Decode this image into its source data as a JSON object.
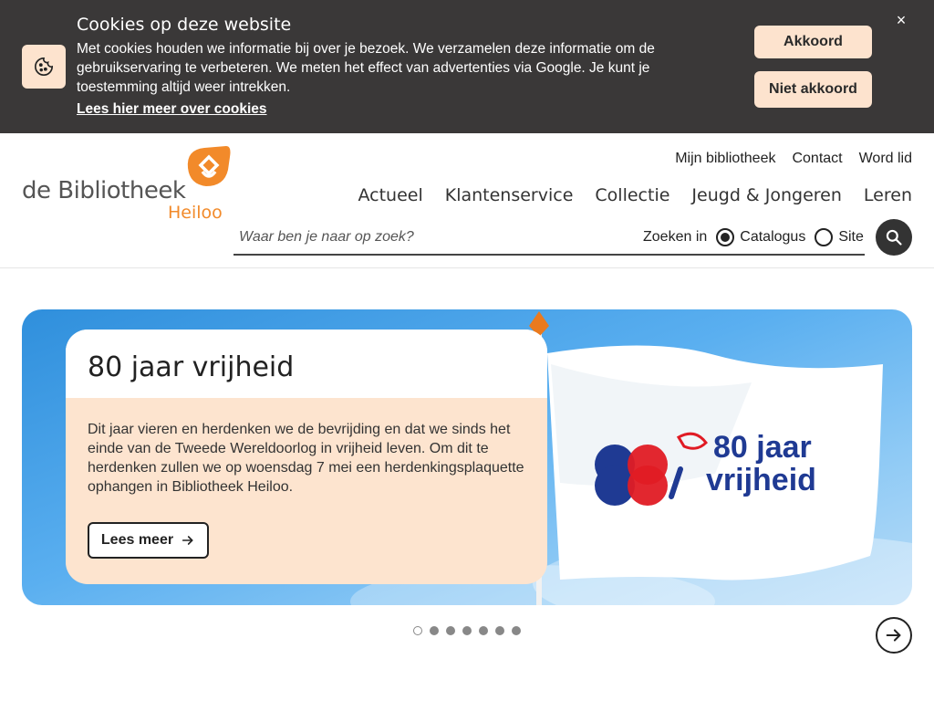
{
  "cookie_banner": {
    "title": "Cookies op deze website",
    "text": "Met cookies houden we informatie bij over je bezoek. We verzamelen deze informatie om de gebruikservaring te verbeteren. We meten het effect van advertenties via Google. Je kunt je toestemming altijd weer intrekken.",
    "link": "Lees hier meer over cookies",
    "accept_label": "Akkoord",
    "decline_label": "Niet akkoord",
    "close_label": "×"
  },
  "logo": {
    "name": "de Bibliotheek",
    "location": "Heiloo"
  },
  "top_links": [
    "Mijn bibliotheek",
    "Contact",
    "Word lid"
  ],
  "main_nav": [
    "Actueel",
    "Klantenservice",
    "Collectie",
    "Jeugd & Jongeren",
    "Leren"
  ],
  "search": {
    "placeholder": "Waar ben je naar op zoek?",
    "scope_label": "Zoeken in",
    "options": [
      "Catalogus",
      "Site"
    ],
    "selected": "Catalogus"
  },
  "hero": {
    "title": "80 jaar vrijheid",
    "text": "Dit jaar vieren en herdenken we de bevrijding en dat we sinds het einde van de Tweede Wereldoorlog in vrijheid leven. Om dit te herdenken zullen we op woensdag 7 mei een herdenkingsplaquette ophangen in Bibliotheek Heiloo.",
    "button_label": "Lees meer",
    "flag_line1": "80 jaar",
    "flag_line2": "vrijheid"
  },
  "carousel": {
    "slide_count": 7,
    "active_index": 0
  },
  "colors": {
    "cookie_bg": "#3a3838",
    "accent_peach": "#fde3ce",
    "brand_orange": "#f28a2a",
    "flag_blue": "#1f3a93",
    "flag_red": "#e01b24"
  }
}
